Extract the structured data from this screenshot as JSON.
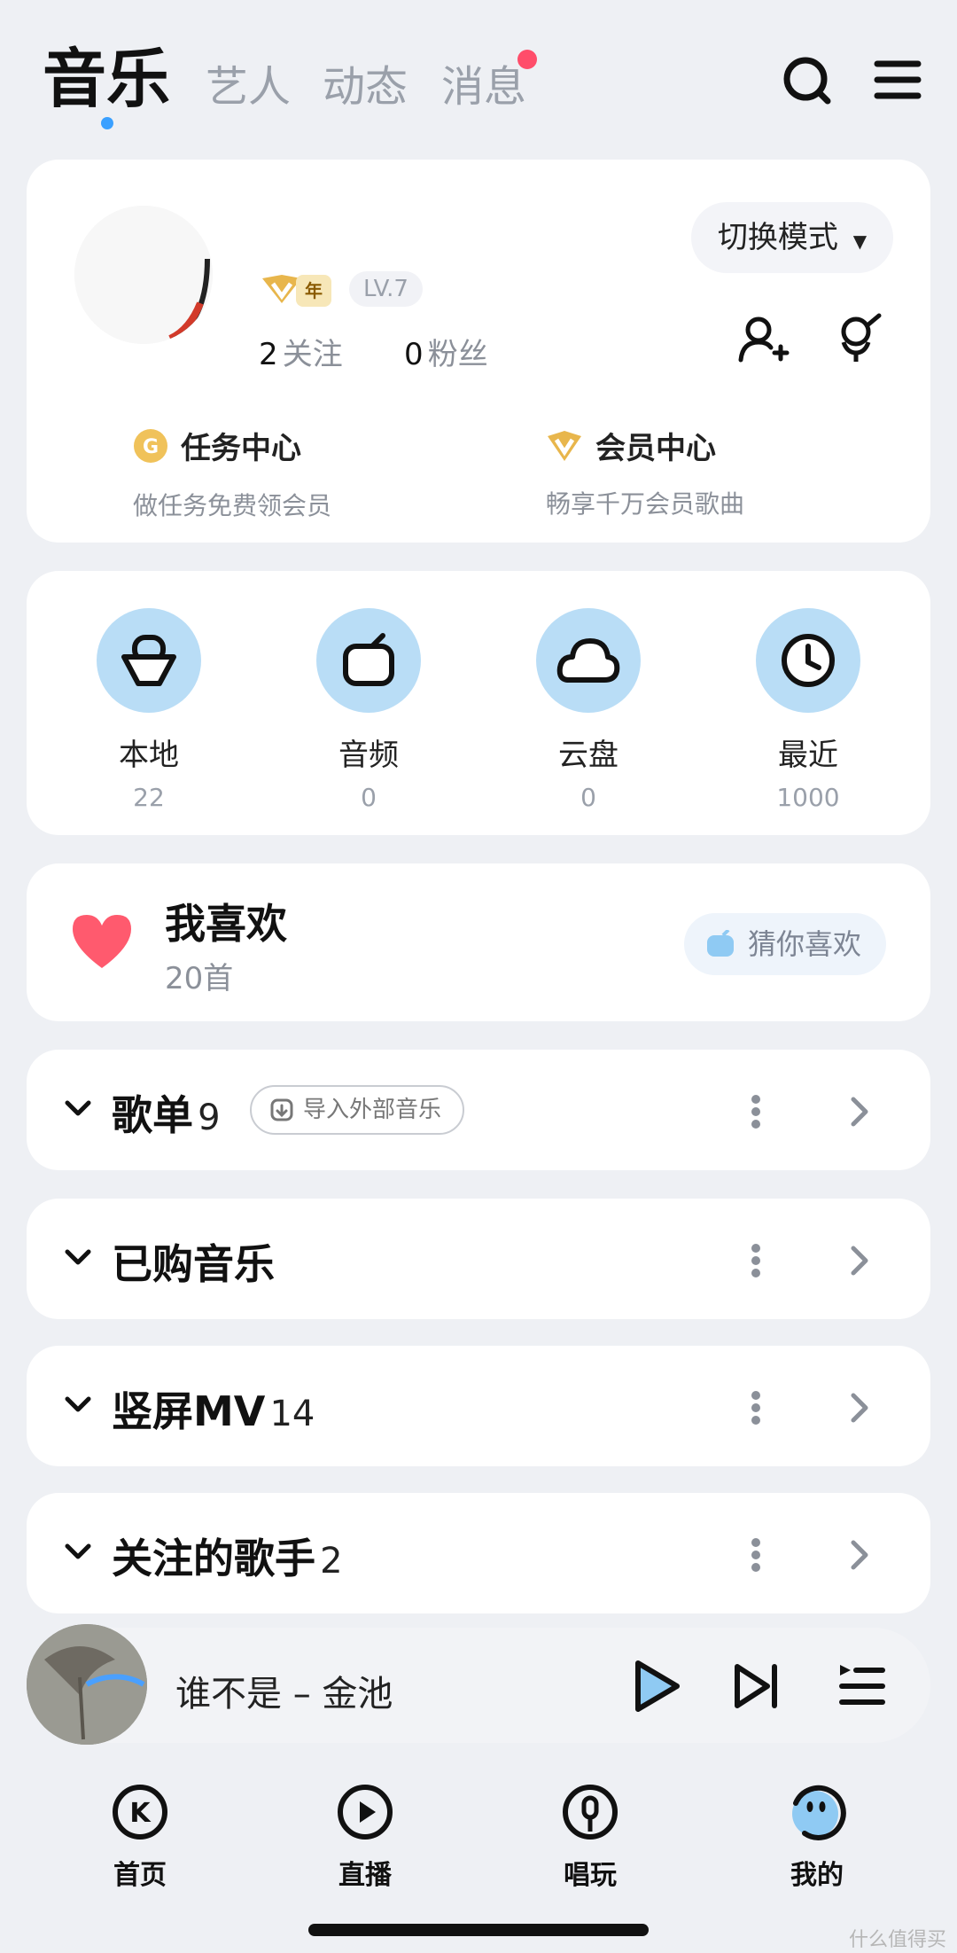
{
  "tabs": {
    "main": "音乐",
    "artist": "艺人",
    "feed": "动态",
    "messages": "消息"
  },
  "profile": {
    "vip_label": "年",
    "level": "LV.7",
    "following_count": "2",
    "following_label": "关注",
    "followers_count": "0",
    "followers_label": "粉丝",
    "mode_button": "切换模式"
  },
  "centers": {
    "task_title": "任务中心",
    "task_sub": "做任务免费领会员",
    "vip_title": "会员中心",
    "vip_sub": "畅享千万会员歌曲"
  },
  "quick": [
    {
      "label": "本地",
      "count": "22",
      "icon": "local-music-icon"
    },
    {
      "label": "音频",
      "count": "0",
      "icon": "radio-icon"
    },
    {
      "label": "云盘",
      "count": "0",
      "icon": "cloud-icon"
    },
    {
      "label": "最近",
      "count": "1000",
      "icon": "clock-icon"
    }
  ],
  "favorites": {
    "title": "我喜欢",
    "count": "20首",
    "guess_button": "猜你喜欢"
  },
  "sections": [
    {
      "title": "歌单",
      "count": "9",
      "extra": "导入外部音乐"
    },
    {
      "title": "已购音乐",
      "count": ""
    },
    {
      "title": "竖屏MV",
      "count": "14"
    },
    {
      "title": "关注的歌手",
      "count": "2"
    }
  ],
  "player": {
    "song": "谁不是 – 金池"
  },
  "nav": {
    "home": "首页",
    "live": "直播",
    "sing": "唱玩",
    "mine": "我的"
  },
  "watermark": "什么值得买",
  "colors": {
    "accent": "#3aa0ff",
    "heart": "#ff5a6e",
    "quick_circle": "#b9ddf6",
    "vip_gold": "#e8b64c"
  }
}
